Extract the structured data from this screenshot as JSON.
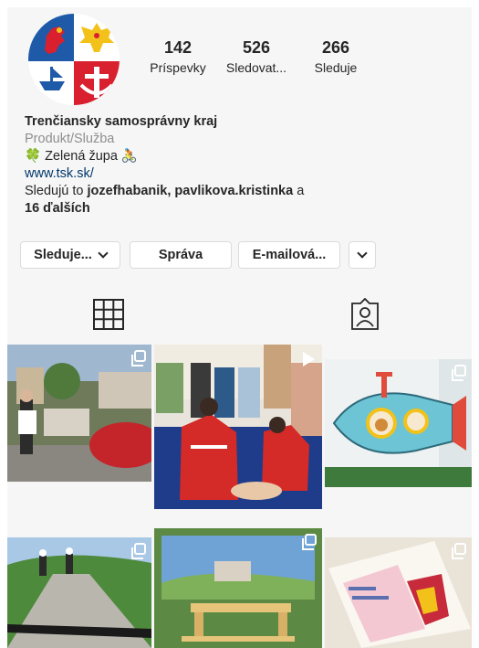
{
  "profile": {
    "name": "Trenčiansky samosprávny kraj",
    "category": "Produkt/Služba",
    "tagline": "🍀 Zelená župa 🚴",
    "website": "www.tsk.sk/",
    "followed_by_prefix": "Sledujú to ",
    "followed_by_users": "jozefhabanik, pavlikova.kristinka",
    "followed_by_and": " a",
    "followed_by_others": "16 ďalších"
  },
  "stats": [
    {
      "value": "142",
      "label": "Príspevky"
    },
    {
      "value": "526",
      "label": "Sledovat..."
    },
    {
      "value": "266",
      "label": "Sleduje"
    }
  ],
  "buttons": {
    "following": "Sleduje...",
    "message": "Správa",
    "email": "E-mailová...",
    "more_icon": "chevron-down-icon"
  },
  "tabs": {
    "grid_icon": "grid-icon",
    "tagged_icon": "tagged-person-icon"
  },
  "posts": [
    {
      "type": "carousel",
      "icon": "carousel-icon"
    },
    {
      "type": "video",
      "icon": "play-icon"
    },
    {
      "type": "carousel",
      "icon": "carousel-icon"
    },
    {
      "type": "carousel",
      "icon": "carousel-icon"
    },
    {
      "type": "carousel",
      "icon": "carousel-icon"
    },
    {
      "type": "carousel",
      "icon": "carousel-icon"
    }
  ],
  "colors": {
    "link": "#00376b",
    "muted": "#8e8e8e",
    "coat_red": "#d8202f",
    "coat_blue": "#1e5aa8"
  }
}
